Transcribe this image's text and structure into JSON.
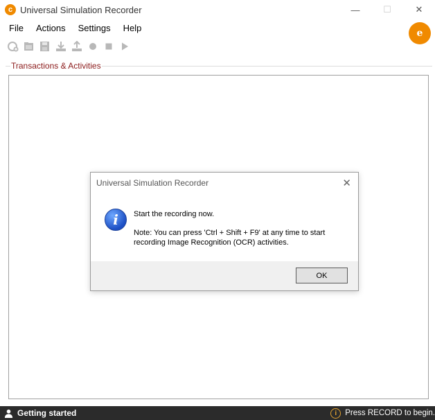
{
  "window": {
    "title": "Universal Simulation Recorder",
    "minimize_glyph": "—",
    "maximize_glyph": "☐",
    "close_glyph": "✕"
  },
  "menu": {
    "items": [
      "File",
      "Actions",
      "Settings",
      "Help"
    ]
  },
  "toolbar": {
    "icons": [
      "new-recording-icon",
      "open-folder-icon",
      "save-icon",
      "download-icon",
      "upload-icon",
      "record-icon",
      "stop-icon",
      "play-icon"
    ]
  },
  "group": {
    "label": "Transactions & Activities"
  },
  "dialog": {
    "title": "Universal Simulation Recorder",
    "close_glyph": "✕",
    "message": "Start the recording now.",
    "note": "Note: You can press 'Ctrl + Shift + F9' at any time to start recording Image Recognition (OCR) activities.",
    "ok_label": "OK"
  },
  "status": {
    "left_text": "Getting started",
    "right_text": "Press RECORD to begin."
  },
  "colors": {
    "brand": "#f08a00",
    "group_label": "#8b1a1a",
    "statusbar_bg": "#2b2b2b",
    "info_accent": "#e0a030"
  }
}
